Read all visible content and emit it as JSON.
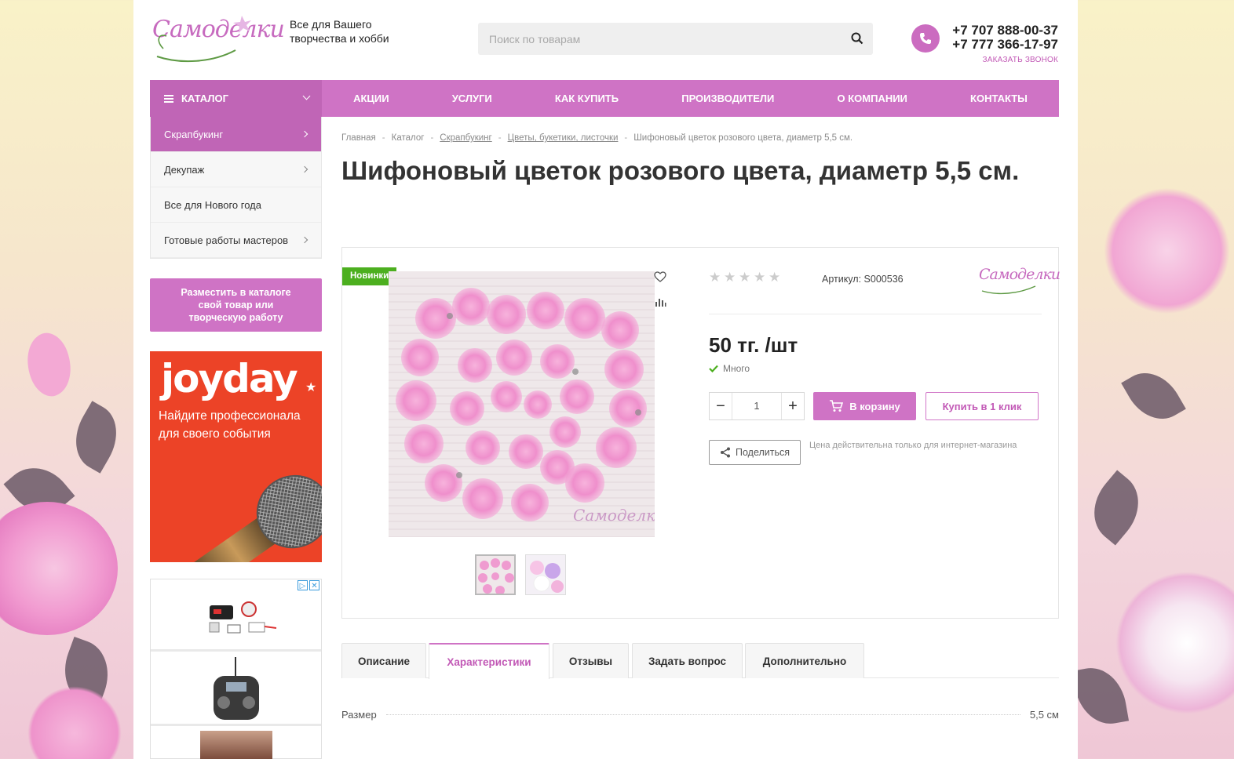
{
  "header": {
    "logo_text": "Самоделки",
    "tagline": "Все для Вашего творчества и хобби",
    "search_placeholder": "Поиск по товарам",
    "phone1": "+7 707 888-00-37",
    "phone2": "+7 777 366-17-97",
    "callback": "ЗАКАЗАТЬ ЗВОНОК"
  },
  "nav": {
    "catalog": "КАТАЛОГ",
    "items": [
      "АКЦИИ",
      "УСЛУГИ",
      "КАК КУПИТЬ",
      "ПРОИЗВОДИТЕЛИ",
      "О КОМПАНИИ",
      "КОНТАКТЫ"
    ]
  },
  "sidebar": {
    "items": [
      {
        "label": "Скрапбукинг",
        "active": true,
        "arrow": true
      },
      {
        "label": "Декупаж",
        "active": false,
        "arrow": true
      },
      {
        "label": "Все для Нового года",
        "active": false,
        "arrow": false
      },
      {
        "label": "Готовые работы мастеров",
        "active": false,
        "arrow": true
      }
    ],
    "promo_button": "Разместить в каталоге свой товар или творческую работу",
    "banner": {
      "logo": "joyday",
      "text": "Найдите профессионала для своего события"
    }
  },
  "breadcrumb": {
    "items": [
      "Главная",
      "Каталог",
      "Скрапбукинг",
      "Цветы, букетики, листочки",
      "Шифоновый цветок розового цвета, диаметр 5,5 см."
    ],
    "separator": "-"
  },
  "product": {
    "title": "Шифоновый цветок розового цвета, диаметр 5,5 см.",
    "badge": "Новинки",
    "article": "Артикул: S000536",
    "price": "50 тг. /шт",
    "stock": "Много",
    "quantity": "1",
    "cart_button": "В корзину",
    "one_click_button": "Купить в 1 клик",
    "share_button": "Поделиться",
    "price_note": "Цена действительна только для интернет-магазина",
    "rating": 0,
    "watermark": "Самоделки"
  },
  "tabs": {
    "items": [
      "Описание",
      "Характеристики",
      "Отзывы",
      "Задать вопрос",
      "Дополнительно"
    ],
    "active": "Характеристики"
  },
  "specs": [
    {
      "name": "Размер",
      "value": "5,5 см"
    }
  ],
  "colors": {
    "accent": "#cf73c5",
    "accent_dark": "#c065b6",
    "badge_green": "#4caf1f",
    "banner_red": "#ec4327"
  }
}
